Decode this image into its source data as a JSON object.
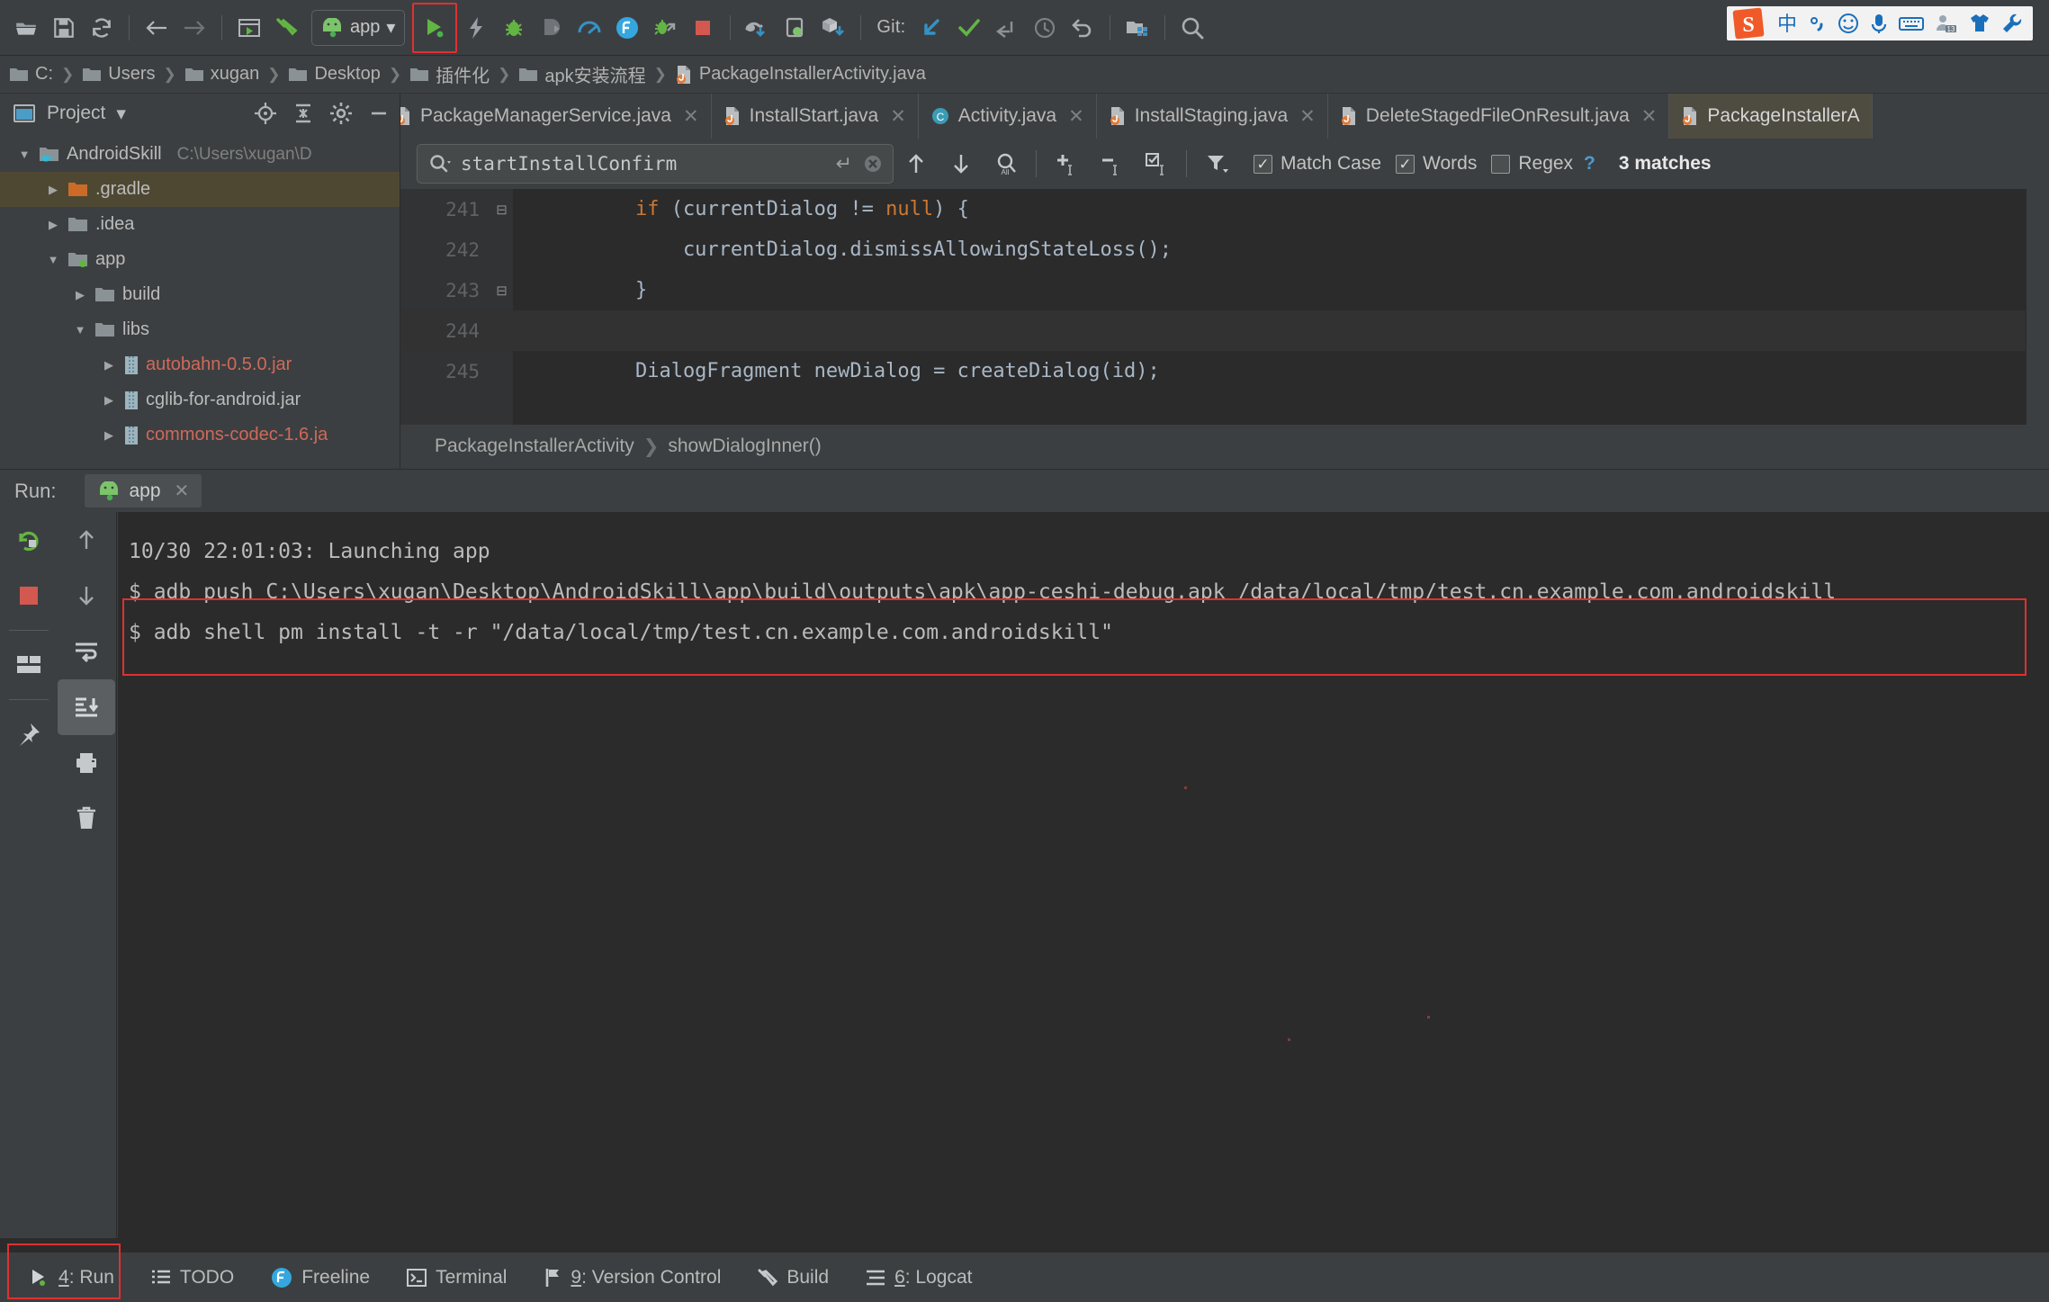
{
  "toolbar": {
    "buttons": [
      {
        "name": "open-icon",
        "label": "Open"
      },
      {
        "name": "save-all-icon",
        "label": "Save All"
      },
      {
        "name": "sync-icon",
        "label": "Synchronize"
      },
      {
        "name": "back-icon",
        "label": "Back"
      },
      {
        "name": "forward-icon",
        "label": "Forward"
      },
      {
        "name": "avd-manager-icon",
        "label": "AVD Manager"
      },
      {
        "name": "build-hammer-icon",
        "label": "Make Project"
      }
    ],
    "run_config_label": "app",
    "run_config_dropdown": "▾",
    "actions": [
      {
        "name": "run-icon",
        "label": "Run 'app'"
      },
      {
        "name": "apply-changes-icon",
        "label": "Apply Changes"
      },
      {
        "name": "debug-icon",
        "label": "Debug 'app'"
      },
      {
        "name": "attach-debugger-icon",
        "label": "Attach Debugger to Android Process"
      },
      {
        "name": "profiler-icon",
        "label": "Profile 'app'"
      },
      {
        "name": "freeline-icon",
        "label": "Freeline"
      },
      {
        "name": "run-with-coverage-icon",
        "label": "Run with Coverage"
      },
      {
        "name": "stop-icon",
        "label": "Stop"
      },
      {
        "name": "gradle-sync-icon",
        "label": "Sync Project with Gradle Files"
      },
      {
        "name": "avd-device-icon",
        "label": "AVD Manager"
      },
      {
        "name": "sdk-manager-icon",
        "label": "SDK Manager"
      }
    ],
    "git_label": "Git:",
    "git_actions": [
      {
        "name": "git-update-icon",
        "label": "Update Project"
      },
      {
        "name": "git-commit-icon",
        "label": "Commit"
      },
      {
        "name": "git-push-icon",
        "label": "Push"
      },
      {
        "name": "git-history-icon",
        "label": "Show History"
      },
      {
        "name": "git-revert-icon",
        "label": "Revert"
      }
    ],
    "tail_actions": [
      {
        "name": "project-structure-icon",
        "label": "Project Structure"
      },
      {
        "name": "search-everywhere-icon",
        "label": "Search Everywhere"
      }
    ]
  },
  "ime": {
    "logo": "S",
    "items": [
      {
        "name": "ime-chinese-icon",
        "glyph": "中"
      },
      {
        "name": "ime-punctuation-icon",
        "glyph": "°,"
      },
      {
        "name": "ime-emoji-icon",
        "glyph": "☺"
      },
      {
        "name": "ime-voice-icon",
        "glyph": "🎤"
      },
      {
        "name": "ime-keyboard-icon",
        "glyph": "⌨"
      },
      {
        "name": "ime-account-icon",
        "glyph": "13"
      },
      {
        "name": "ime-skin-icon",
        "glyph": "👕"
      },
      {
        "name": "ime-tools-icon",
        "glyph": "🔧"
      }
    ]
  },
  "breadcrumb": {
    "items": [
      {
        "label": "C:",
        "icon": "folder-icon"
      },
      {
        "label": "Users",
        "icon": "folder-icon"
      },
      {
        "label": "xugan",
        "icon": "folder-icon"
      },
      {
        "label": "Desktop",
        "icon": "folder-icon"
      },
      {
        "label": "插件化",
        "icon": "folder-icon"
      },
      {
        "label": "apk安装流程",
        "icon": "folder-icon"
      },
      {
        "label": "PackageInstallerActivity.java",
        "icon": "java-file-icon"
      }
    ],
    "separator": "❯"
  },
  "project": {
    "title": "Project",
    "dropdown": "▾",
    "header_buttons": [
      {
        "name": "locate-file-icon",
        "label": "Select Opened File"
      },
      {
        "name": "collapse-all-icon",
        "label": "Collapse All"
      },
      {
        "name": "settings-gear-icon",
        "label": "Settings"
      },
      {
        "name": "hide-icon",
        "label": "Hide"
      }
    ],
    "tree": [
      {
        "label": "AndroidSkill",
        "path": "C:\\Users\\xugan\\D",
        "arrow": "▼",
        "indent": 0,
        "icon": "module-icon",
        "selected": false,
        "color": "normal"
      },
      {
        "label": ".gradle",
        "path": "",
        "arrow": "▶",
        "indent": 1,
        "icon": "folder-orange-icon",
        "selected": true,
        "color": "normal"
      },
      {
        "label": ".idea",
        "path": "",
        "arrow": "▶",
        "indent": 1,
        "icon": "folder-icon",
        "selected": false,
        "color": "normal"
      },
      {
        "label": "app",
        "path": "",
        "arrow": "▼",
        "indent": 1,
        "icon": "module-folder-icon",
        "selected": false,
        "color": "normal"
      },
      {
        "label": "build",
        "path": "",
        "arrow": "▶",
        "indent": 2,
        "icon": "folder-icon",
        "selected": false,
        "color": "normal"
      },
      {
        "label": "libs",
        "path": "",
        "arrow": "▼",
        "indent": 2,
        "icon": "folder-icon",
        "selected": false,
        "color": "normal"
      },
      {
        "label": "autobahn-0.5.0.jar",
        "path": "",
        "arrow": "▶",
        "indent": 3,
        "icon": "jar-icon",
        "selected": false,
        "color": "red"
      },
      {
        "label": "cglib-for-android.jar",
        "path": "",
        "arrow": "▶",
        "indent": 3,
        "icon": "jar-icon",
        "selected": false,
        "color": "normal"
      },
      {
        "label": "commons-codec-1.6.ja",
        "path": "",
        "arrow": "▶",
        "indent": 3,
        "icon": "jar-icon",
        "selected": false,
        "color": "red"
      }
    ]
  },
  "editor_tabs": [
    {
      "label": "PackageManagerService.java",
      "icon": "java-file-icon",
      "active": false,
      "close": "✕"
    },
    {
      "label": "InstallStart.java",
      "icon": "java-file-icon",
      "active": false,
      "close": "✕"
    },
    {
      "label": "Activity.java",
      "icon": "class-icon",
      "active": false,
      "close": "✕"
    },
    {
      "label": "InstallStaging.java",
      "icon": "java-file-icon",
      "active": false,
      "close": "✕"
    },
    {
      "label": "DeleteStagedFileOnResult.java",
      "icon": "java-file-icon",
      "active": false,
      "close": "✕"
    },
    {
      "label": "PackageInstallerA",
      "icon": "java-file-icon",
      "active": true,
      "close": ""
    }
  ],
  "find": {
    "search_icon": "search-icon",
    "dropdown": "▾",
    "value": "startInstallConfirm",
    "placeholder": "Search",
    "enter_icon": "↵",
    "clear_icon": "✕",
    "buttons": [
      {
        "name": "find-previous-icon",
        "glyph": "↑"
      },
      {
        "name": "find-next-icon",
        "glyph": "↓"
      },
      {
        "name": "select-all-occurrences-icon",
        "glyph": "All"
      },
      {
        "name": "add-selection-next-icon",
        "glyph": "+"
      },
      {
        "name": "remove-selection-icon",
        "glyph": "−"
      },
      {
        "name": "select-all-icon",
        "glyph": "☑"
      },
      {
        "name": "filter-icon",
        "glyph": "▼"
      }
    ],
    "match_case_label": "Match Case",
    "match_case_checked": true,
    "words_label": "Words",
    "words_checked": true,
    "regex_label": "Regex",
    "regex_checked": false,
    "help": "?",
    "result_count": "3 matches"
  },
  "code": {
    "lines": [
      {
        "num": "241",
        "fold": "⊟",
        "current": false,
        "tokens": [
          {
            "t": "        ",
            "c": "plain"
          },
          {
            "t": "if",
            "c": "kw"
          },
          {
            "t": " (currentDialog != ",
            "c": "plain"
          },
          {
            "t": "null",
            "c": "kw"
          },
          {
            "t": ") {",
            "c": "plain"
          }
        ]
      },
      {
        "num": "242",
        "fold": "",
        "current": false,
        "tokens": [
          {
            "t": "            currentDialog.dismissAllowingStateLoss();",
            "c": "plain"
          }
        ]
      },
      {
        "num": "243",
        "fold": "⊟",
        "current": false,
        "tokens": [
          {
            "t": "        }",
            "c": "plain"
          }
        ]
      },
      {
        "num": "244",
        "fold": "",
        "current": true,
        "tokens": [
          {
            "t": "",
            "c": "plain"
          }
        ]
      },
      {
        "num": "245",
        "fold": "",
        "current": false,
        "tokens": [
          {
            "t": "        DialogFragment newDialog = createDialog(id);",
            "c": "plain"
          }
        ]
      }
    ],
    "breadcrumb_class": "PackageInstallerActivity",
    "breadcrumb_sep": "❯",
    "breadcrumb_method": "showDialogInner()"
  },
  "run_panel": {
    "label": "Run:",
    "tab_label": "app",
    "tab_icon": "android-icon",
    "tab_close": "✕",
    "left_buttons": [
      {
        "name": "rerun-icon",
        "label": "Rerun"
      },
      {
        "name": "stop-icon",
        "label": "Stop"
      },
      {
        "name": "layout-inspector-icon",
        "label": "Layout Inspector"
      },
      {
        "name": "pin-tab-icon",
        "label": "Pin Tab"
      }
    ],
    "right_buttons": [
      {
        "name": "scroll-up-icon",
        "label": "Up the Stack Trace"
      },
      {
        "name": "scroll-down-icon",
        "label": "Down the Stack Trace"
      },
      {
        "name": "soft-wrap-icon",
        "label": "Use Soft Wraps"
      },
      {
        "name": "scroll-to-end-icon",
        "label": "Scroll to End",
        "selected": true
      },
      {
        "name": "print-icon",
        "label": "Print"
      },
      {
        "name": "clear-all-icon",
        "label": "Clear All"
      }
    ],
    "console_lines": [
      {
        "text": "10/30 22:01:03: Launching app",
        "highlighted": false
      },
      {
        "text": "$ adb push C:\\Users\\xugan\\Desktop\\AndroidSkill\\app\\build\\outputs\\apk\\app-ceshi-debug.apk /data/local/tmp/test.cn.example.com.androidskill",
        "highlighted": true
      },
      {
        "text": "$ adb shell pm install -t -r \"/data/local/tmp/test.cn.example.com.androidskill\"",
        "highlighted": true
      }
    ]
  },
  "statusbar": {
    "items": [
      {
        "label": "4: Run",
        "icon": "run-icon",
        "mnemonic": "4",
        "highlighted": true
      },
      {
        "label": "TODO",
        "icon": "todo-icon",
        "mnemonic": "",
        "highlighted": false
      },
      {
        "label": "Freeline",
        "icon": "freeline-icon",
        "mnemonic": "",
        "highlighted": false
      },
      {
        "label": "Terminal",
        "icon": "terminal-icon",
        "mnemonic": "",
        "highlighted": false
      },
      {
        "label": "9: Version Control",
        "icon": "version-control-icon",
        "mnemonic": "9",
        "highlighted": false
      },
      {
        "label": "Build",
        "icon": "build-icon",
        "mnemonic": "",
        "highlighted": false
      },
      {
        "label": "6: Logcat",
        "icon": "logcat-icon",
        "mnemonic": "6",
        "highlighted": false
      }
    ]
  },
  "colors": {
    "bg": "#3c3f41",
    "editor_bg": "#2b2b2b",
    "accent_green": "#4caf50",
    "accent_red": "#e03030",
    "accent_blue": "#3592c4",
    "text": "#bbbbbb"
  }
}
